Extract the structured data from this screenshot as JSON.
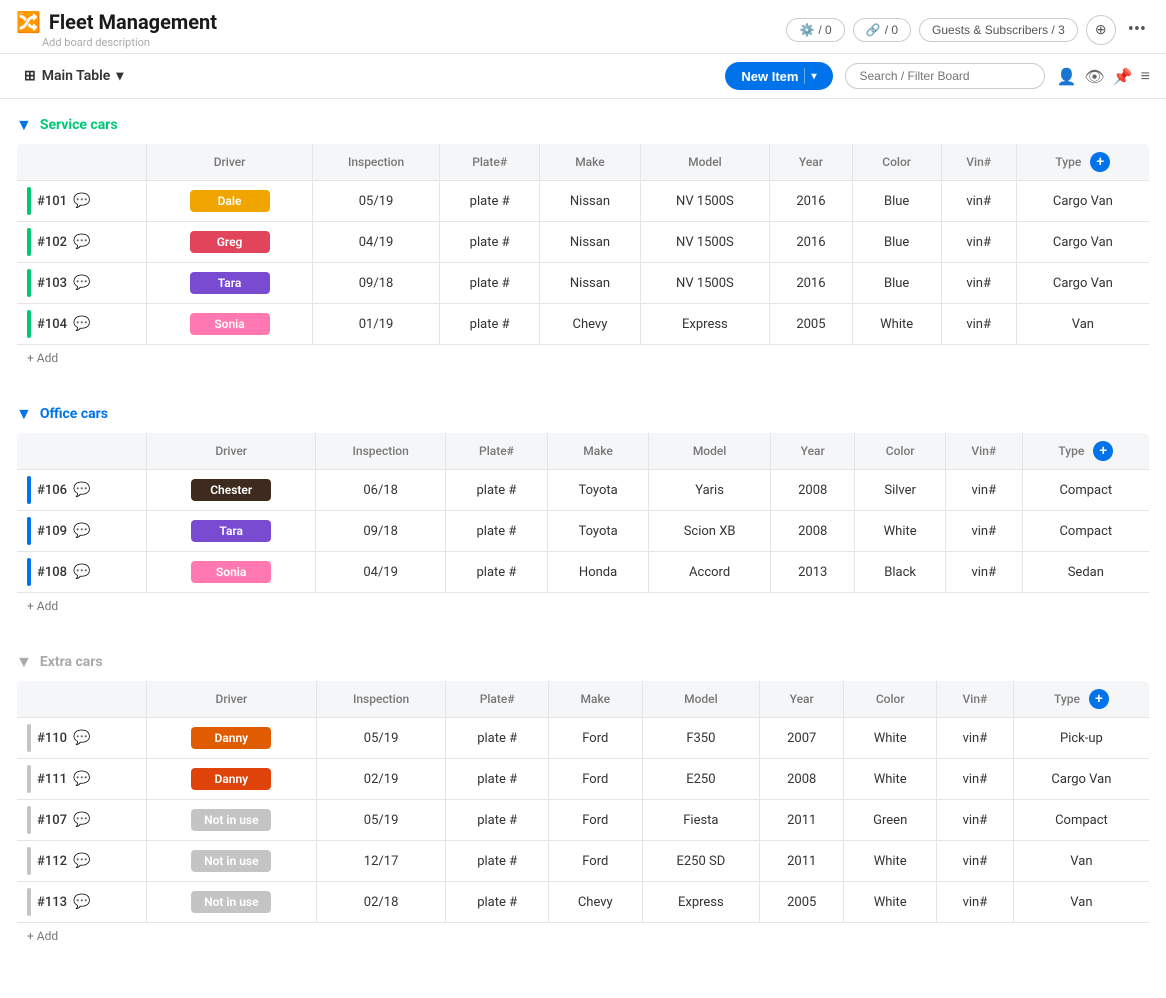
{
  "app": {
    "title": "Fleet Management",
    "subtitle": "Add board description",
    "title_icon": "🔀"
  },
  "header": {
    "automations_label": "/ 0",
    "integrations_label": "/ 0",
    "guests_label": "Guests & Subscribers / 3",
    "more_icon": "•••"
  },
  "toolbar": {
    "main_table_label": "Main Table",
    "new_item_label": "New Item",
    "search_placeholder": "Search / Filter Board"
  },
  "groups": [
    {
      "id": "service_cars",
      "title": "Service cars",
      "color": "green",
      "columns": [
        "Driver",
        "Inspection",
        "Plate#",
        "Make",
        "Model",
        "Year",
        "Color",
        "Vin#",
        "Type"
      ],
      "rows": [
        {
          "id": "#101",
          "driver": "Dale",
          "driver_class": "driver-dale",
          "inspection": "05/19",
          "plate": "plate #",
          "make": "Nissan",
          "model": "NV 1500S",
          "year": "2016",
          "color": "Blue",
          "vin": "vin#",
          "type": "Cargo Van"
        },
        {
          "id": "#102",
          "driver": "Greg",
          "driver_class": "driver-greg",
          "inspection": "04/19",
          "plate": "plate #",
          "make": "Nissan",
          "model": "NV 1500S",
          "year": "2016",
          "color": "Blue",
          "vin": "vin#",
          "type": "Cargo Van"
        },
        {
          "id": "#103",
          "driver": "Tara",
          "driver_class": "driver-tara",
          "inspection": "09/18",
          "plate": "plate #",
          "make": "Nissan",
          "model": "NV 1500S",
          "year": "2016",
          "color": "Blue",
          "vin": "vin#",
          "type": "Cargo Van"
        },
        {
          "id": "#104",
          "driver": "Sonia",
          "driver_class": "driver-sonia",
          "inspection": "01/19",
          "plate": "plate #",
          "make": "Chevy",
          "model": "Express",
          "year": "2005",
          "color": "White",
          "vin": "vin#",
          "type": "Van"
        }
      ]
    },
    {
      "id": "office_cars",
      "title": "Office cars",
      "color": "blue",
      "columns": [
        "Driver",
        "Inspection",
        "Plate#",
        "Make",
        "Model",
        "Year",
        "Color",
        "Vin#",
        "Type"
      ],
      "rows": [
        {
          "id": "#106",
          "driver": "Chester",
          "driver_class": "driver-chester",
          "inspection": "06/18",
          "plate": "plate #",
          "make": "Toyota",
          "model": "Yaris",
          "year": "2008",
          "color": "Silver",
          "vin": "vin#",
          "type": "Compact"
        },
        {
          "id": "#109",
          "driver": "Tara",
          "driver_class": "driver-tara",
          "inspection": "09/18",
          "plate": "plate #",
          "make": "Toyota",
          "model": "Scion XB",
          "year": "2008",
          "color": "White",
          "vin": "vin#",
          "type": "Compact"
        },
        {
          "id": "#108",
          "driver": "Sonia",
          "driver_class": "driver-sonia",
          "inspection": "04/19",
          "plate": "plate #",
          "make": "Honda",
          "model": "Accord",
          "year": "2013",
          "color": "Black",
          "vin": "vin#",
          "type": "Sedan"
        }
      ]
    },
    {
      "id": "extra_cars",
      "title": "Extra cars",
      "color": "grey",
      "columns": [
        "Driver",
        "Inspection",
        "Plate#",
        "Make",
        "Model",
        "Year",
        "Color",
        "Vin#",
        "Type"
      ],
      "rows": [
        {
          "id": "#110",
          "driver": "Danny",
          "driver_class": "driver-danny-orange",
          "inspection": "05/19",
          "plate": "plate #",
          "make": "Ford",
          "model": "F350",
          "year": "2007",
          "color": "White",
          "vin": "vin#",
          "type": "Pick-up"
        },
        {
          "id": "#111",
          "driver": "Danny",
          "driver_class": "driver-danny-red",
          "inspection": "02/19",
          "plate": "plate #",
          "make": "Ford",
          "model": "E250",
          "year": "2008",
          "color": "White",
          "vin": "vin#",
          "type": "Cargo Van"
        },
        {
          "id": "#107",
          "driver": "Not in use",
          "driver_class": "driver-not-in-use",
          "inspection": "05/19",
          "plate": "plate #",
          "make": "Ford",
          "model": "Fiesta",
          "year": "2011",
          "color": "Green",
          "vin": "vin#",
          "type": "Compact"
        },
        {
          "id": "#112",
          "driver": "Not in use",
          "driver_class": "driver-not-in-use",
          "inspection": "12/17",
          "plate": "plate #",
          "make": "Ford",
          "model": "E250 SD",
          "year": "2011",
          "color": "White",
          "vin": "vin#",
          "type": "Van"
        },
        {
          "id": "#113",
          "driver": "Not in use",
          "driver_class": "driver-not-in-use",
          "inspection": "02/18",
          "plate": "plate #",
          "make": "Chevy",
          "model": "Express",
          "year": "2005",
          "color": "White",
          "vin": "vin#",
          "type": "Van"
        }
      ]
    }
  ]
}
